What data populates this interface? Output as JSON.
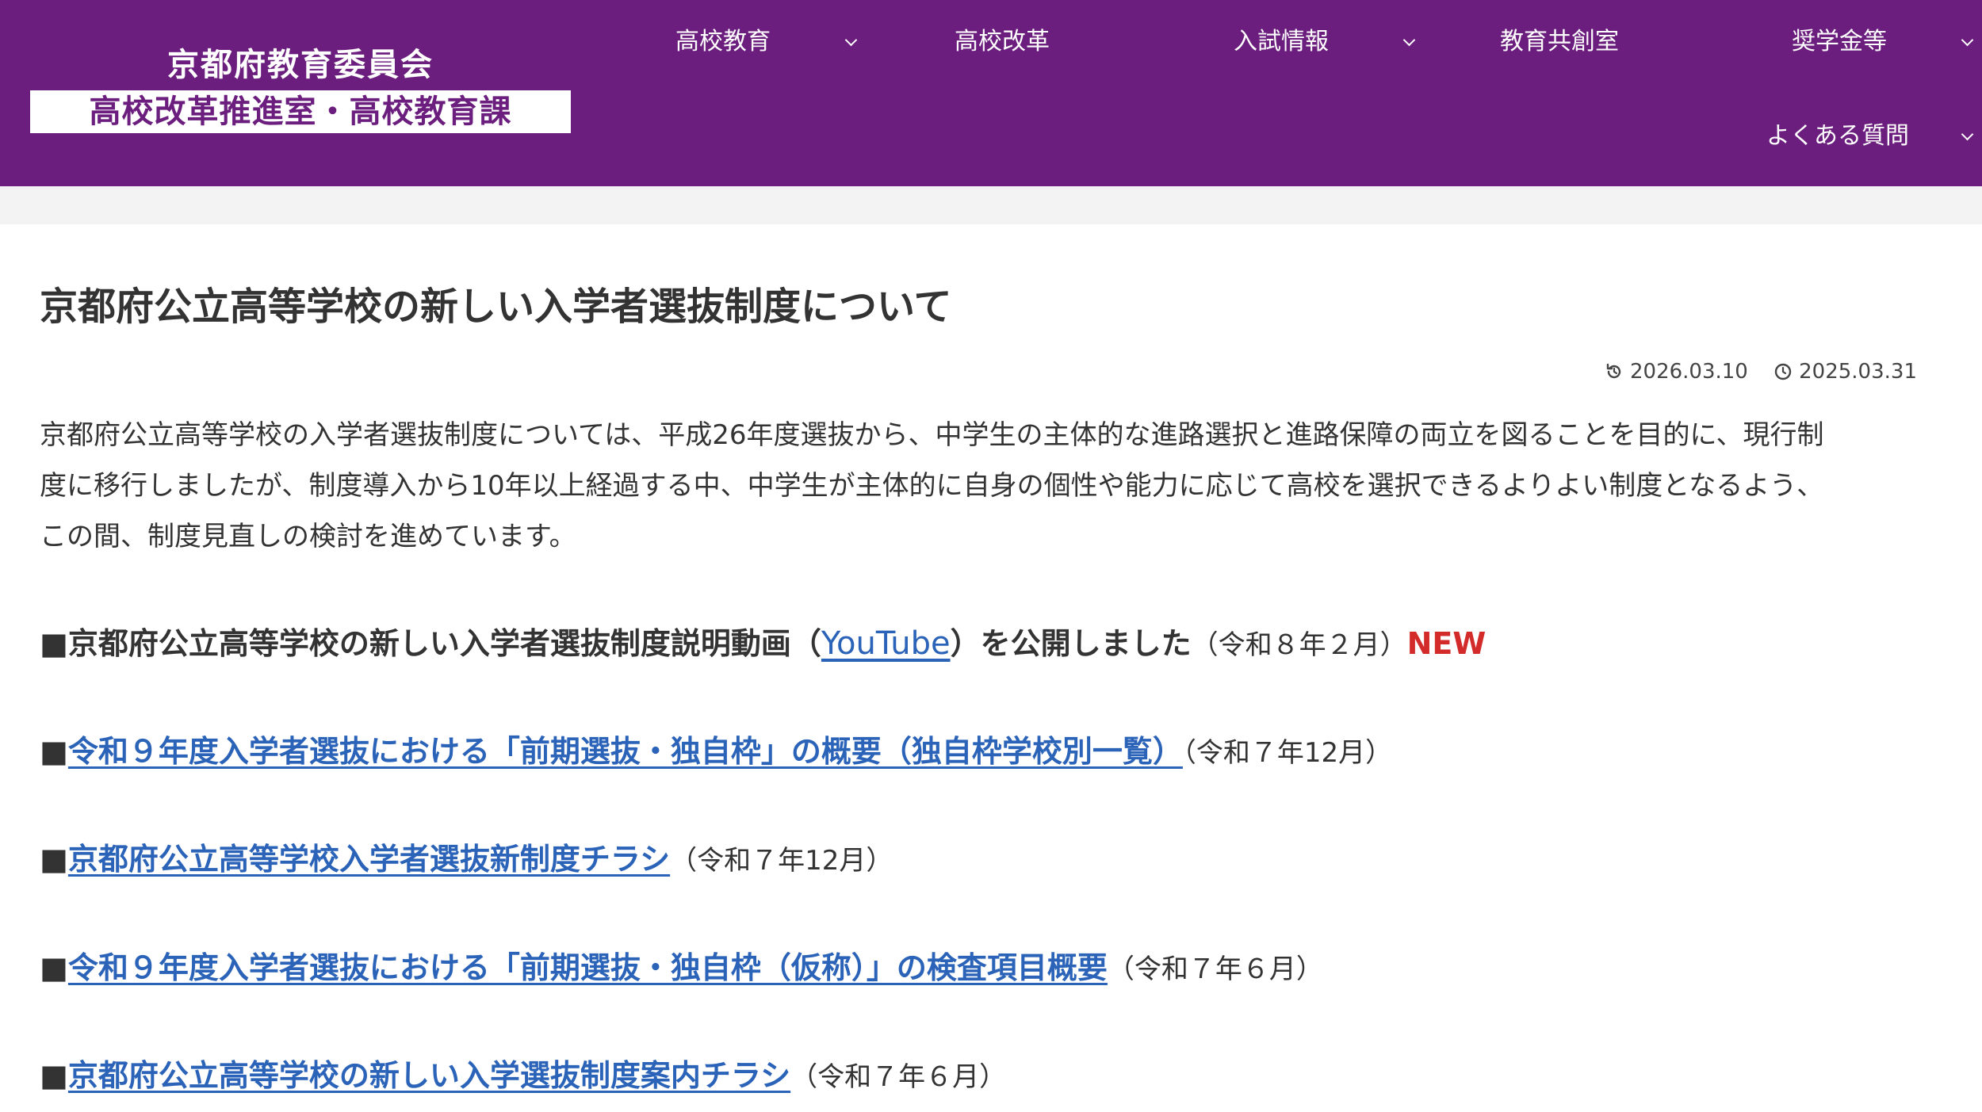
{
  "header": {
    "logo": {
      "line1": "京都府教育委員会",
      "line2": "高校改革推進室・高校教育課"
    },
    "nav": [
      {
        "label": "高校教育",
        "has_dropdown": true
      },
      {
        "label": "高校改革",
        "has_dropdown": false
      },
      {
        "label": "入試情報",
        "has_dropdown": true
      },
      {
        "label": "教育共創室",
        "has_dropdown": false
      },
      {
        "label": "奨学金等",
        "has_dropdown": true
      },
      {
        "label": "よくある質問",
        "has_dropdown": true
      }
    ],
    "colors": {
      "background": "#6b1e7e",
      "text": "#ffffff"
    }
  },
  "article": {
    "title": "京都府公立高等学校の新しい入学者選抜制度について",
    "updated_date": "2026.03.10",
    "published_date": "2025.03.31",
    "intro_lines": [
      "京都府公立高等学校の入学者選抜制度については、平成26年度選抜から、中学生の主体的な進路選択と進路保障の両立を図ることを目的に、現行制",
      "度に移行しましたが、制度導入から10年以上経過する中、中学生が主体的に自身の個性や能力に応じて高校を選択できるよりよい制度となるよう、",
      "この間、制度見直しの検討を進めています。"
    ],
    "bullet": "■",
    "entries": [
      {
        "prefix": "京都府公立高等学校の新しい入学者選抜制度説明動画（",
        "link": "YouTube",
        "suffix": "）を公開しました",
        "date": "（令和８年２月）",
        "badge": "NEW"
      },
      {
        "link": "令和９年度入学者選抜における「前期選抜・独自枠」の概要（独自枠学校別一覧）",
        "date": "（令和７年12月）"
      },
      {
        "link": "京都府公立高等学校入学者選抜新制度チラシ",
        "date": "（令和７年12月）"
      },
      {
        "link": "令和９年度入学者選抜における「前期選抜・独自枠（仮称）」の検査項目概要",
        "date": "（令和７年６月）"
      },
      {
        "link": "京都府公立高等学校の新しい入学選抜制度案内チラシ",
        "date": "（令和７年６月）"
      }
    ],
    "colors": {
      "link": "#2a63b8",
      "new_badge": "#d32a2a",
      "text": "#333333"
    }
  },
  "icons": {
    "updated": "refresh-icon",
    "published": "clock-icon",
    "dropdown": "chevron-down-icon"
  }
}
